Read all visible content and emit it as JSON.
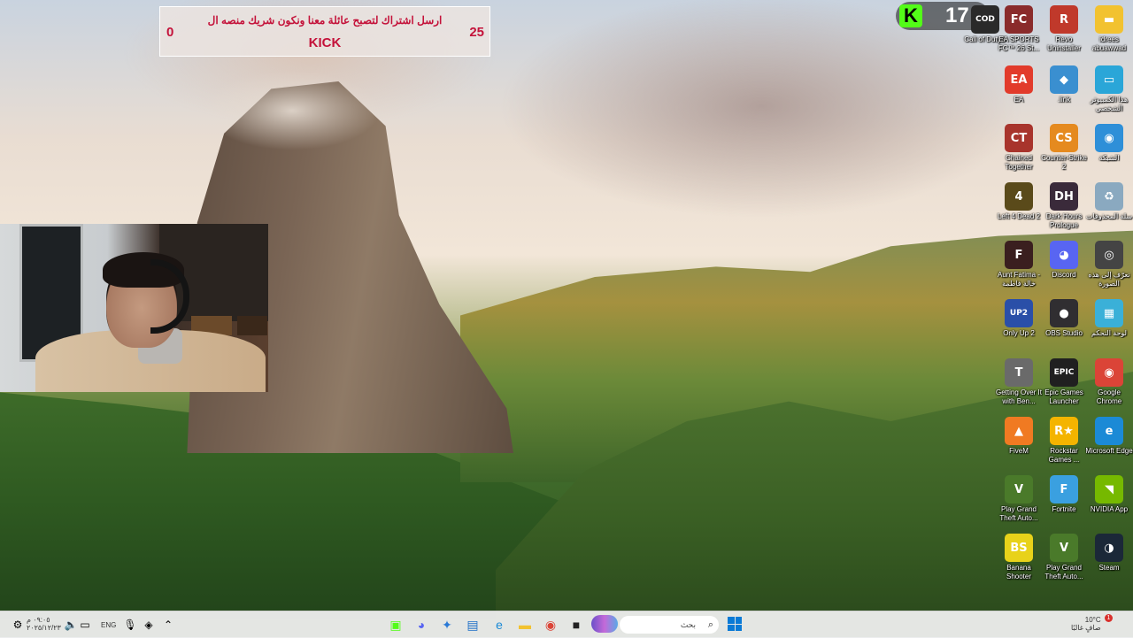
{
  "banner": {
    "message": "ارسل اشتراك لتصبح عائلة معنا ونكون شريك منصه ال",
    "platform": "KICK",
    "goal": "25",
    "current": "0",
    "text_color": "#c4123a"
  },
  "kick_badge": {
    "logo_letter": "K",
    "count": "17",
    "color": "#53fc18"
  },
  "desktop_icons": [
    {
      "label": "Call of Duty®",
      "icon": "call-of-duty-icon",
      "glyph": "COD",
      "color": "#2a2a2a"
    },
    {
      "label": "EA SPORTS FC™ 26 St...",
      "icon": "ea-sports-fc-icon",
      "glyph": "FC",
      "color": "#8a2b2b"
    },
    {
      "label": "Revo Uninstaller",
      "icon": "revo-uninstaller-icon",
      "glyph": "R",
      "color": "#c0392b"
    },
    {
      "label": "idrees abuawwad",
      "icon": "folder-icon",
      "glyph": "▬",
      "color": "#f2c230"
    },
    {
      "label": "EA",
      "icon": "ea-icon",
      "glyph": "EA",
      "color": "#e23b2b"
    },
    {
      "label": ".link",
      "icon": "link-game-icon",
      "glyph": "◆",
      "color": "#3a8fd0"
    },
    {
      "label": "هذا الكمبيوتر الشخصي",
      "icon": "this-pc-icon",
      "glyph": "▭",
      "color": "#2aa6d8"
    },
    {
      "label": "Chained Together",
      "icon": "chained-together-icon",
      "glyph": "CT",
      "color": "#a8342c"
    },
    {
      "label": "Counter-Strike 2",
      "icon": "counter-strike-icon",
      "glyph": "CS",
      "color": "#e58a1f"
    },
    {
      "label": "الشبكة",
      "icon": "network-icon",
      "glyph": "◉",
      "color": "#2e8fd8"
    },
    {
      "label": "Left 4 Dead 2",
      "icon": "left-4-dead-icon",
      "glyph": "4",
      "color": "#5a4a1a"
    },
    {
      "label": "Dark Hours Prologue",
      "icon": "dark-hours-icon",
      "glyph": "DH",
      "color": "#3a2a3a"
    },
    {
      "label": "سلة المحذوفات",
      "icon": "recycle-bin-icon",
      "glyph": "♻",
      "color": "#8aa9c0"
    },
    {
      "label": "Aunt Fatima - خالة فاطمة",
      "icon": "aunt-fatima-icon",
      "glyph": "F",
      "color": "#3a1f1f"
    },
    {
      "label": "Discord",
      "icon": "discord-icon",
      "glyph": "◕",
      "color": "#5865f2"
    },
    {
      "label": "تعرّف إلى هذه الصورة",
      "icon": "learn-about-picture-icon",
      "glyph": "◎",
      "color": "#444444"
    },
    {
      "label": "Only Up 2",
      "icon": "only-up-icon",
      "glyph": "UP2",
      "color": "#2a4fa8"
    },
    {
      "label": "OBS Studio",
      "icon": "obs-studio-icon",
      "glyph": "●",
      "color": "#302e31"
    },
    {
      "label": "لوحة التحكم",
      "icon": "control-panel-icon",
      "glyph": "▦",
      "color": "#3ab0d8"
    },
    {
      "label": "Getting Over It with Ben...",
      "icon": "getting-over-it-icon",
      "glyph": "T",
      "color": "#6a6a6a"
    },
    {
      "label": "Epic Games Launcher",
      "icon": "epic-games-icon",
      "glyph": "EPIC",
      "color": "#202020"
    },
    {
      "label": "Google Chrome",
      "icon": "chrome-icon",
      "glyph": "◉",
      "color": "#db4437"
    },
    {
      "label": "FiveM",
      "icon": "fivem-icon",
      "glyph": "▲",
      "color": "#f07a22"
    },
    {
      "label": "Rockstar Games ...",
      "icon": "rockstar-icon",
      "glyph": "R★",
      "color": "#f4b400"
    },
    {
      "label": "Microsoft Edge",
      "icon": "edge-icon",
      "glyph": "e",
      "color": "#1b8ad6"
    },
    {
      "label": "Play Grand Theft Auto...",
      "icon": "gta-icon",
      "glyph": "V",
      "color": "#4a7a2a"
    },
    {
      "label": "Fortnite",
      "icon": "fortnite-icon",
      "glyph": "F",
      "color": "#3aa0e0"
    },
    {
      "label": "NVIDIA App",
      "icon": "nvidia-icon",
      "glyph": "◥",
      "color": "#76b900"
    },
    {
      "label": "Banana Shooter",
      "icon": "banana-shooter-icon",
      "glyph": "BS",
      "color": "#e8d21a"
    },
    {
      "label": "Play Grand Theft Auto...",
      "icon": "gta-icon",
      "glyph": "V",
      "color": "#4a7a2a"
    },
    {
      "label": "Steam",
      "icon": "steam-icon",
      "glyph": "◑",
      "color": "#1b2838"
    }
  ],
  "taskbar": {
    "search_placeholder": "بحث",
    "language": "ENG",
    "clock_time": "٠٩:٠٥ م",
    "clock_date": "٢٠٢٥/١٢/٢٣",
    "weather_temp": "10°C",
    "weather_desc": "صافٍ غالبًا",
    "notification_count": "1",
    "pinned": [
      {
        "name": "kick-app-icon",
        "glyph": "▣",
        "color": "#53fc18"
      },
      {
        "name": "discord-taskbar-icon",
        "glyph": "◕",
        "color": "#5865f2"
      },
      {
        "name": "app-taskbar-icon",
        "glyph": "✦",
        "color": "#2a7ad6"
      },
      {
        "name": "store-taskbar-icon",
        "glyph": "▤",
        "color": "#1f6fc7"
      },
      {
        "name": "edge-taskbar-icon",
        "glyph": "e",
        "color": "#1b8ad6"
      },
      {
        "name": "file-explorer-icon",
        "glyph": "▬",
        "color": "#f2c230"
      },
      {
        "name": "chrome-taskbar-icon",
        "glyph": "◉",
        "color": "#db4437"
      },
      {
        "name": "terminal-taskbar-icon",
        "glyph": "■",
        "color": "#222222"
      }
    ]
  }
}
